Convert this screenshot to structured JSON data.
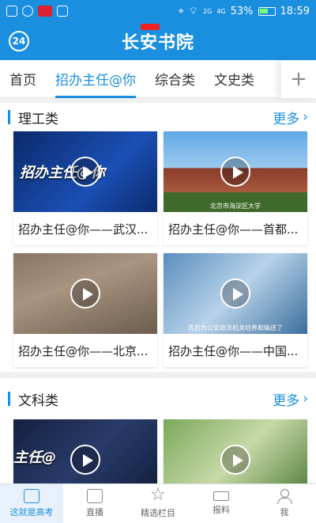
{
  "status": {
    "battery": "53%",
    "time": "18:59",
    "net1": "2G",
    "net2": "4G"
  },
  "app": {
    "badge": "24",
    "logo": "长安书院"
  },
  "tabs": [
    "首页",
    "招办主任@你",
    "综合类",
    "文史类"
  ],
  "tab_plus": "+",
  "sections": [
    {
      "title": "理工类",
      "more": "更多",
      "cards": [
        {
          "caption": "招办主任@你——武汉...",
          "overlay": "招办主任@你",
          "sub": ""
        },
        {
          "caption": "招办主任@你——首都...",
          "overlay": "",
          "sub": "北京市海淀区大学"
        },
        {
          "caption": "招办主任@你——北京...",
          "overlay": "",
          "sub": ""
        },
        {
          "caption": "招办主任@你——中国...",
          "overlay": "",
          "sub": "先后为公安政法机关培养和输送了"
        }
      ]
    },
    {
      "title": "文科类",
      "more": "更多",
      "cards": [
        {
          "caption": "",
          "overlay": "主任@",
          "sub": ""
        },
        {
          "caption": "",
          "overlay": "",
          "sub": ""
        }
      ]
    }
  ],
  "bottom_nav": [
    "这就是高考",
    "直播",
    "精选栏目",
    "报料",
    "我"
  ],
  "colors": {
    "accent": "#1a8fe0"
  }
}
